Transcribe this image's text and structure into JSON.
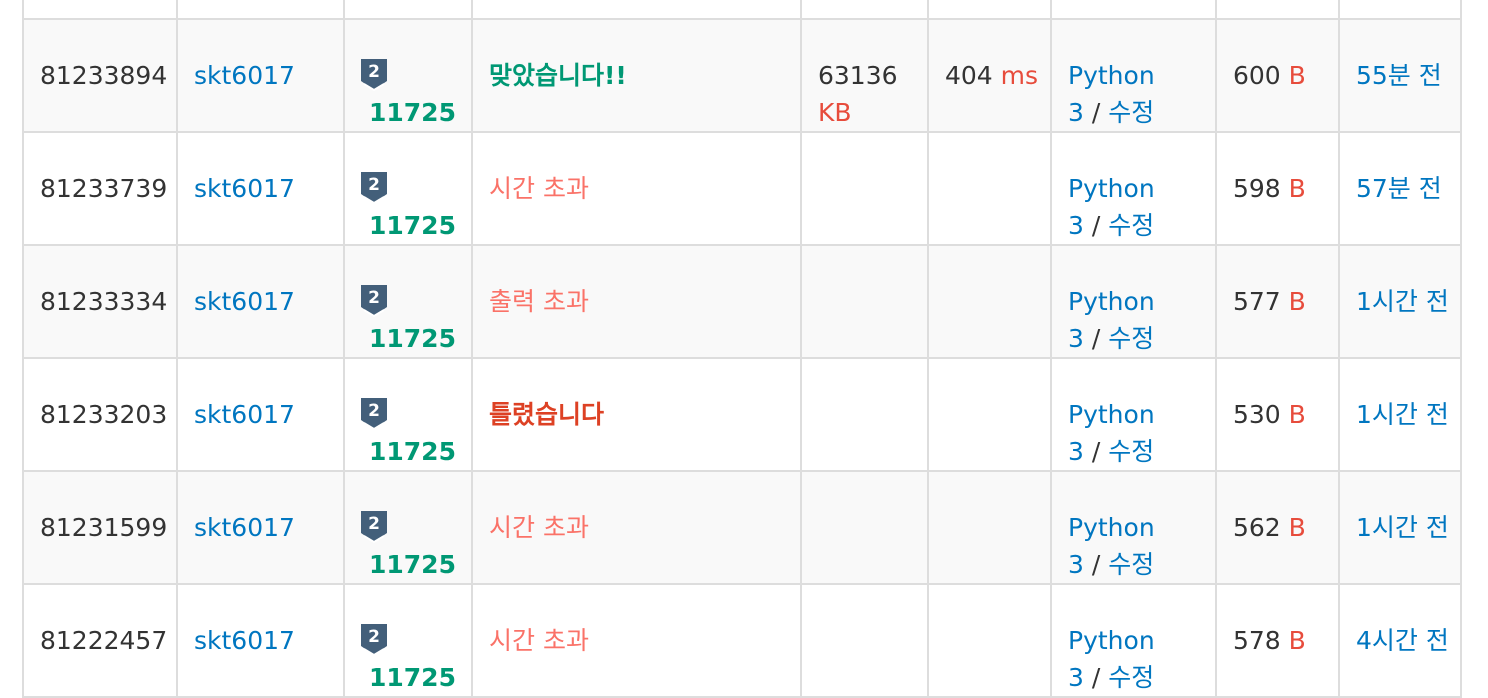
{
  "colors": {
    "link": "#0076c0",
    "accepted": "#009874",
    "wrong": "#dd4124",
    "timeout": "#fa7268",
    "unit": "#e74c3c",
    "tier_badge": "#435f7a",
    "border": "#dddddd",
    "row_alt": "#f9f9f9"
  },
  "tier_icon": "silver-2-tier-icon",
  "tier_label": "2",
  "rows": [
    {
      "submission_id": "81233894",
      "user": "skt6017",
      "problem": "11725",
      "result": "맞았습니다!!",
      "result_type": "ac",
      "memory": "63136",
      "memory_unit": "KB",
      "time": "404",
      "time_unit": "ms",
      "lang": "Python 3",
      "sep": "/",
      "edit": "수정",
      "code_length": "600",
      "code_length_unit": "B",
      "submitted": "55분 전"
    },
    {
      "submission_id": "81233739",
      "user": "skt6017",
      "problem": "11725",
      "result": "시간 초과",
      "result_type": "tle",
      "memory": "",
      "memory_unit": "",
      "time": "",
      "time_unit": "",
      "lang": "Python 3",
      "sep": "/",
      "edit": "수정",
      "code_length": "598",
      "code_length_unit": "B",
      "submitted": "57분 전"
    },
    {
      "submission_id": "81233334",
      "user": "skt6017",
      "problem": "11725",
      "result": "출력 초과",
      "result_type": "ole",
      "memory": "",
      "memory_unit": "",
      "time": "",
      "time_unit": "",
      "lang": "Python 3",
      "sep": "/",
      "edit": "수정",
      "code_length": "577",
      "code_length_unit": "B",
      "submitted": "1시간 전"
    },
    {
      "submission_id": "81233203",
      "user": "skt6017",
      "problem": "11725",
      "result": "틀렸습니다",
      "result_type": "wa",
      "memory": "",
      "memory_unit": "",
      "time": "",
      "time_unit": "",
      "lang": "Python 3",
      "sep": "/",
      "edit": "수정",
      "code_length": "530",
      "code_length_unit": "B",
      "submitted": "1시간 전"
    },
    {
      "submission_id": "81231599",
      "user": "skt6017",
      "problem": "11725",
      "result": "시간 초과",
      "result_type": "tle",
      "memory": "",
      "memory_unit": "",
      "time": "",
      "time_unit": "",
      "lang": "Python 3",
      "sep": "/",
      "edit": "수정",
      "code_length": "562",
      "code_length_unit": "B",
      "submitted": "1시간 전"
    },
    {
      "submission_id": "81222457",
      "user": "skt6017",
      "problem": "11725",
      "result": "시간 초과",
      "result_type": "tle",
      "memory": "",
      "memory_unit": "",
      "time": "",
      "time_unit": "",
      "lang": "Python 3",
      "sep": "/",
      "edit": "수정",
      "code_length": "578",
      "code_length_unit": "B",
      "submitted": "4시간 전"
    }
  ]
}
